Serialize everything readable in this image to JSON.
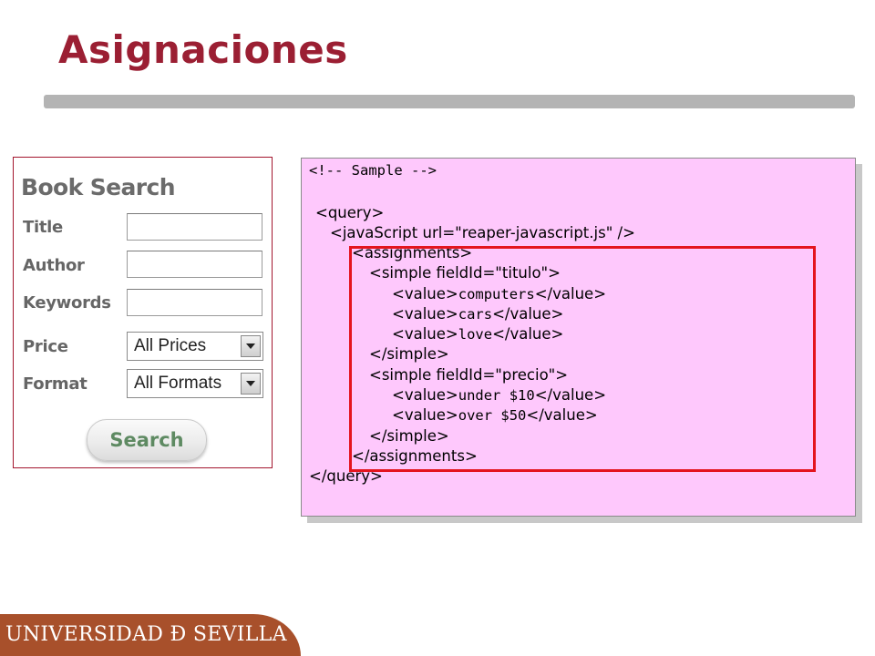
{
  "slide": {
    "title": "Asignaciones",
    "title_color": "#9b1f33",
    "footer": "UNIVERSIDAD Ð SEVILLA",
    "footer_color": "#a8502b"
  },
  "form": {
    "heading": "Book Search",
    "fields": [
      {
        "label": "Title",
        "value": ""
      },
      {
        "label": "Author",
        "value": ""
      },
      {
        "label": "Keywords",
        "value": ""
      }
    ],
    "selects": [
      {
        "label": "Price",
        "selected": "All Prices"
      },
      {
        "label": "Format",
        "selected": "All Formats"
      }
    ],
    "button_label": "Search",
    "button_text_color": "#5e8a62"
  },
  "code": {
    "background": "#fec8fc",
    "highlight_color": "#e4141e",
    "lines": [
      "<!-- Sample -->",
      "<query>",
      "<javaScript url=\"reaper-javascript.js\" />",
      "<assignments>",
      "<simple fieldId=\"titulo\">",
      "<value>",
      "computers",
      "</value>",
      "<value>",
      "cars",
      "</value>",
      "<value>",
      "love",
      "</value>",
      "</simple>",
      "<simple fieldId=\"precio\">",
      "<value>",
      "under $10",
      "</value>",
      "<value>",
      "over $50",
      "</value>",
      "</simple>",
      "</assignments>",
      "</query>"
    ]
  }
}
